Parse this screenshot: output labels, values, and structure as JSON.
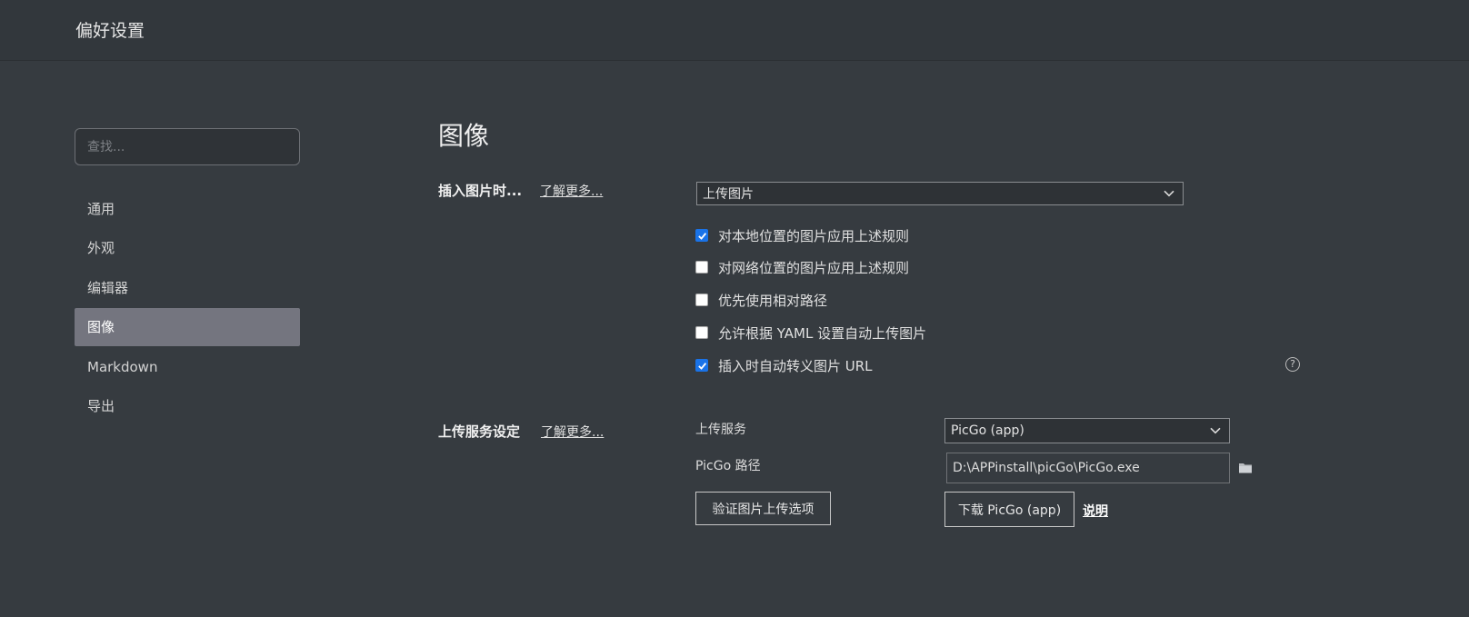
{
  "window": {
    "title": "偏好设置"
  },
  "search": {
    "placeholder": "查找..."
  },
  "sidebar": {
    "items": [
      {
        "label": "通用"
      },
      {
        "label": "外观"
      },
      {
        "label": "编辑器"
      },
      {
        "label": "图像",
        "active": true
      },
      {
        "label": "Markdown"
      },
      {
        "label": "导出"
      }
    ]
  },
  "main": {
    "title": "图像",
    "insert": {
      "label": "插入图片时...",
      "learn_more": "了解更多...",
      "select_value": "上传图片",
      "options": [
        {
          "label": "对本地位置的图片应用上述规则",
          "checked": true
        },
        {
          "label": "对网络位置的图片应用上述规则",
          "checked": false
        },
        {
          "label": "优先使用相对路径",
          "checked": false
        },
        {
          "label": "允许根据 YAML 设置自动上传图片",
          "checked": false
        },
        {
          "label": "插入时自动转义图片 URL",
          "checked": true
        }
      ],
      "help_icon": "question-circle-icon"
    },
    "upload": {
      "label": "上传服务设定",
      "learn_more": "了解更多...",
      "service_label": "上传服务",
      "service_value": "PicGo (app)",
      "path_label": "PicGo 路径",
      "path_value": "D:\\APPinstall\\picGo\\PicGo.exe",
      "folder_icon": "folder-icon",
      "validate_button": "验证图片上传选项",
      "download_button": "下载 PicGo (app)",
      "explain_link": "说明"
    }
  },
  "colors": {
    "background": "#363b40",
    "active_nav": "#74757f",
    "checkbox": "#1a73e8"
  }
}
